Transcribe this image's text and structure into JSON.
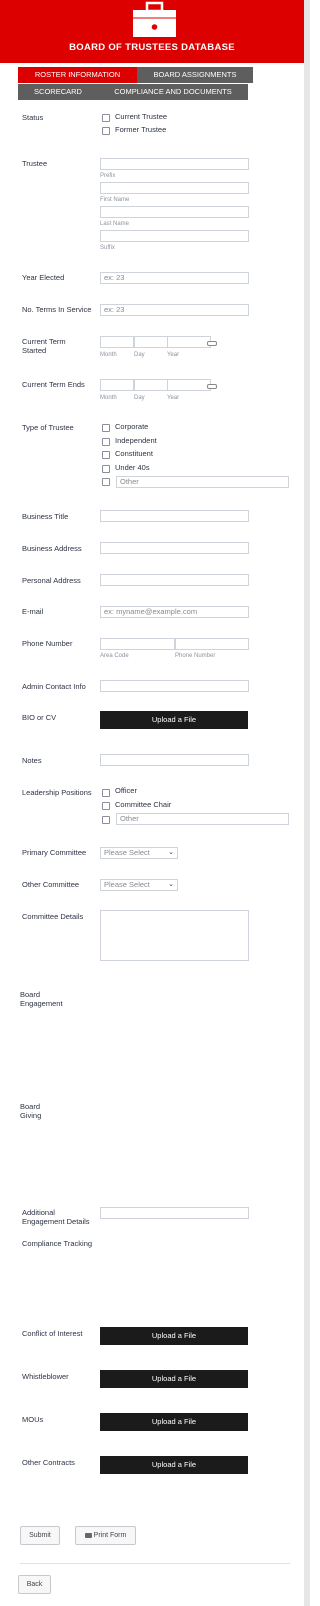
{
  "header": {
    "title": "BOARD OF TRUSTEES DATABASE"
  },
  "tabs": [
    {
      "label": "ROSTER INFORMATION",
      "color": "#dd0000"
    },
    {
      "label": "BOARD ASSIGNMENTS",
      "color": "#5e5e5e"
    },
    {
      "label": "SCORECARD",
      "color": "#5e5e5e"
    },
    {
      "label": "COMPLIANCE AND DOCUMENTS",
      "color": "#5e5e5e"
    }
  ],
  "form": {
    "status": {
      "label": "Status",
      "options": [
        "Current Trustee",
        "Former Trustee"
      ]
    },
    "trustee": {
      "label": "Trustee",
      "sublabels": [
        "Prefix",
        "First Name",
        "Last Name",
        "Suffix"
      ]
    },
    "year_elected": {
      "label": "Year Elected",
      "placeholder": "ex: 23"
    },
    "no_terms": {
      "label": "No. Terms In Service",
      "placeholder": "ex: 23"
    },
    "current_term_started": {
      "label_line1": "Current Term",
      "label_line2": "Started",
      "sublabels": [
        "Month",
        "Day",
        "Year"
      ]
    },
    "current_term_ends": {
      "label": "Current Term Ends",
      "sublabels": [
        "Month",
        "Day",
        "Year"
      ]
    },
    "type_of_trustee": {
      "label": "Type of Trustee",
      "options": [
        "Corporate",
        "Independent",
        "Constituent",
        "Under 40s"
      ],
      "other_placeholder": "Other"
    },
    "business_title": {
      "label": "Business Title"
    },
    "business_address": {
      "label": "Business Address"
    },
    "personal_address": {
      "label": "Personal Address"
    },
    "email": {
      "label": "E-mail",
      "placeholder": "ex: myname@example.com"
    },
    "phone": {
      "label": "Phone Number",
      "sublabels": [
        "Area Code",
        "Phone Number"
      ]
    },
    "admin_contact": {
      "label": "Admin Contact Info"
    },
    "bio": {
      "label": "BIO or CV",
      "button": "Upload a File"
    },
    "notes": {
      "label": "Notes"
    },
    "leadership": {
      "label": "Leadership Positions",
      "options": [
        "Officer",
        "Committee Chair"
      ],
      "other_placeholder": "Other"
    },
    "primary_committee": {
      "label": "Primary Committee",
      "value": "Please Select"
    },
    "other_committee": {
      "label": "Other Committee",
      "value": "Please Select"
    },
    "committee_details": {
      "label": "Committee Details"
    },
    "board_engagement": {
      "line1": "Board",
      "line2": "Engagement"
    },
    "board_giving": {
      "line1": "Board",
      "line2": "Giving"
    },
    "additional_engagement": {
      "line1": "Additional",
      "line2": "Engagement Details"
    },
    "compliance_tracking": {
      "label": "Compliance Tracking"
    },
    "conflict_of_interest": {
      "label": "Conflict of Interest",
      "button": "Upload a File"
    },
    "whistleblower": {
      "label": "Whistleblower",
      "button": "Upload a File"
    },
    "mous": {
      "label": "MOUs",
      "button": "Upload a File"
    },
    "other_contracts": {
      "label": "Other Contracts",
      "button": "Upload a File"
    }
  },
  "actions": {
    "submit": "Submit",
    "print": "Print Form",
    "back": "Back"
  }
}
